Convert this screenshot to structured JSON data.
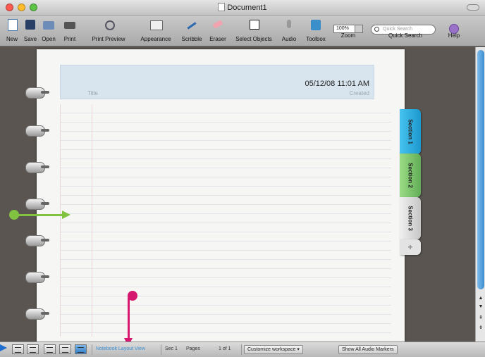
{
  "window": {
    "title": "Document1"
  },
  "toolbar": {
    "items": [
      {
        "label": "New",
        "icon": "new-document-icon"
      },
      {
        "label": "Save",
        "icon": "save-icon"
      },
      {
        "label": "Open",
        "icon": "open-icon"
      },
      {
        "label": "Print",
        "icon": "print-icon"
      },
      {
        "label": "Print Preview",
        "icon": "print-preview-icon"
      },
      {
        "label": "Appearance",
        "icon": "appearance-icon"
      },
      {
        "label": "Scribble",
        "icon": "scribble-pen-icon"
      },
      {
        "label": "Eraser",
        "icon": "eraser-icon"
      },
      {
        "label": "Select Objects",
        "icon": "select-objects-icon"
      },
      {
        "label": "Audio",
        "icon": "microphone-icon"
      },
      {
        "label": "Toolbox",
        "icon": "toolbox-icon"
      },
      {
        "label": "Zoom",
        "icon": ""
      },
      {
        "label": "Quick Search",
        "icon": ""
      },
      {
        "label": "Help",
        "icon": "help-icon"
      }
    ],
    "zoom_value": "100%",
    "search_placeholder": "Quick Search"
  },
  "notebook": {
    "date_time": "05/12/08 11:01 AM",
    "title_placeholder": "Title",
    "created_label": "Created",
    "sections": [
      {
        "label": "Section 1",
        "color": "#2aa8de"
      },
      {
        "label": "Section 2",
        "color": "#7cc66a"
      },
      {
        "label": "Section 3",
        "color": "#d9d9d9"
      }
    ],
    "add_section": "+"
  },
  "status": {
    "view_mode": "Notebook Layout View",
    "section": "Sec 1",
    "pages_label": "Pages",
    "pages_value": "1 of 1",
    "customize": "Customize workspace ▾",
    "audio_markers": "Show All Audio Markers"
  },
  "annotations": {
    "green": "#82c241",
    "pink": "#d6186f",
    "blue": "#1e6fd0"
  }
}
